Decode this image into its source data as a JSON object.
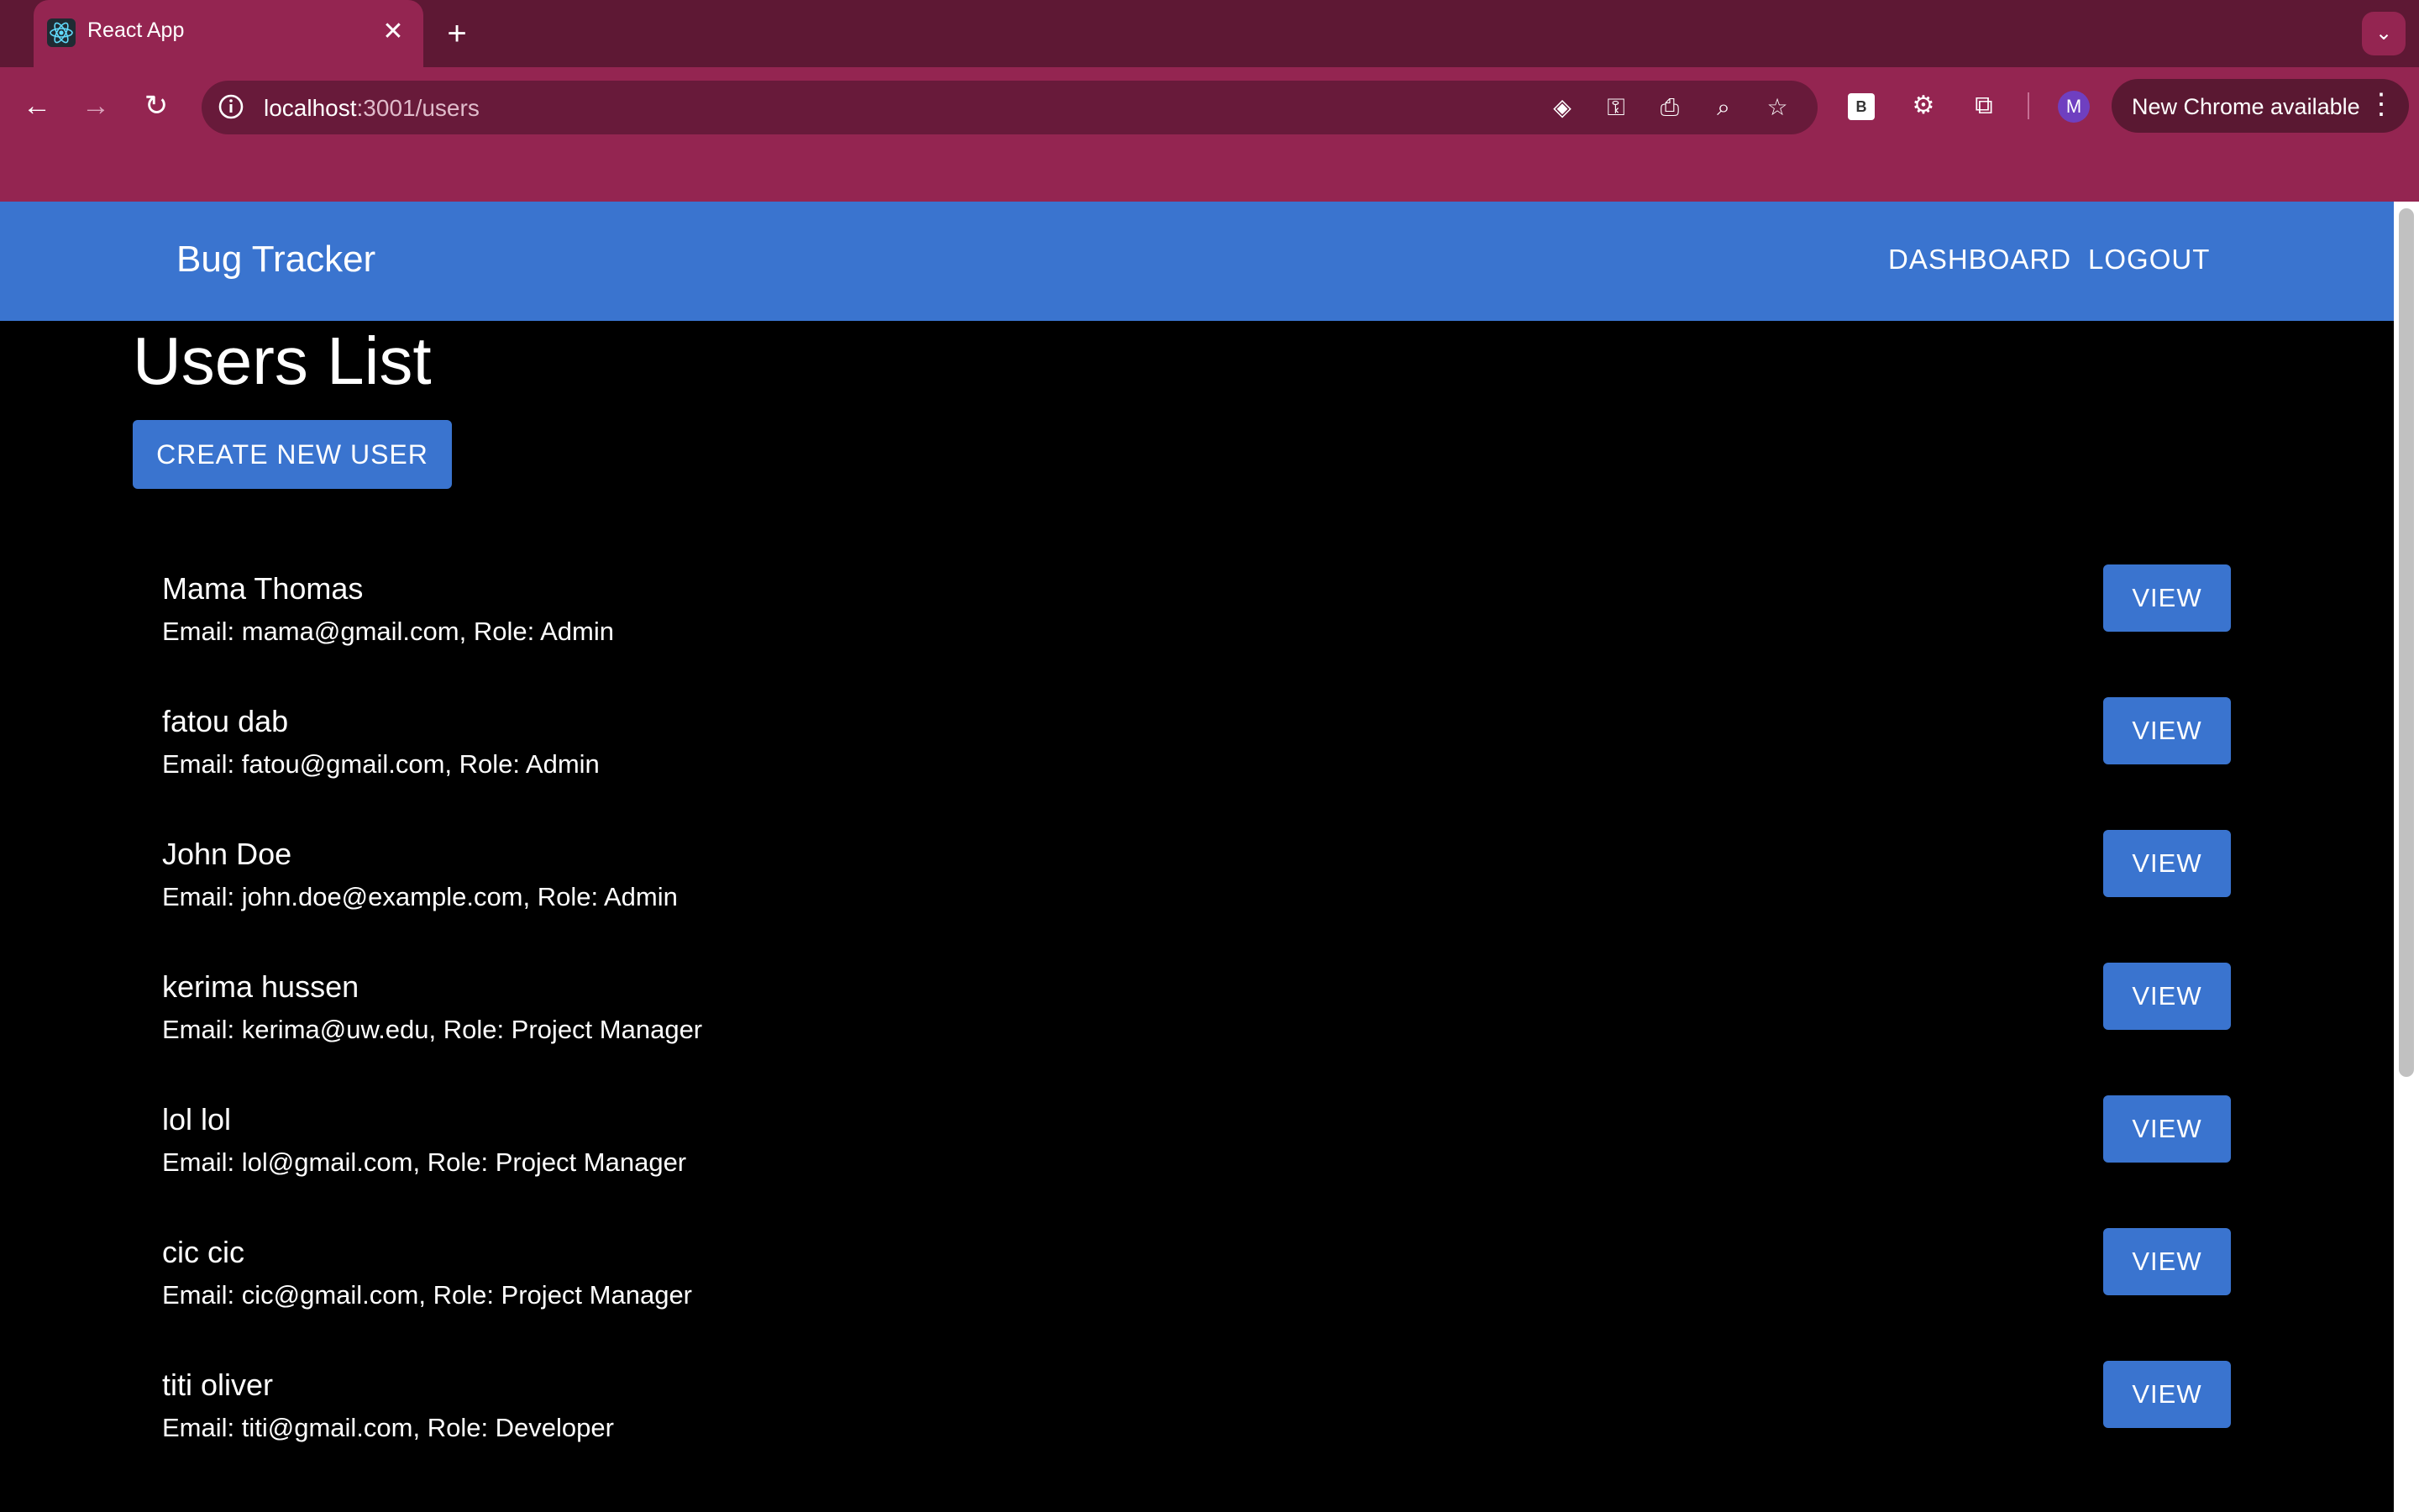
{
  "browser": {
    "tab_title": "React App",
    "url_host": "localhost",
    "url_rest": ":3001/users",
    "update_label": "New Chrome available",
    "profile_initial": "M",
    "ext_b_label": "B"
  },
  "app": {
    "brand": "Bug Tracker",
    "nav": {
      "dashboard": "DASHBOARD",
      "logout": "LOGOUT"
    }
  },
  "page": {
    "title": "Users List",
    "create_label": "CREATE NEW USER",
    "view_label": "VIEW"
  },
  "users": [
    {
      "name": "Mama Thomas",
      "detail": "Email: mama@gmail.com, Role: Admin"
    },
    {
      "name": "fatou dab",
      "detail": "Email: fatou@gmail.com, Role: Admin"
    },
    {
      "name": "John Doe",
      "detail": "Email: john.doe@example.com, Role: Admin"
    },
    {
      "name": "kerima hussen",
      "detail": "Email: kerima@uw.edu, Role: Project Manager"
    },
    {
      "name": "lol lol",
      "detail": "Email: lol@gmail.com, Role: Project Manager"
    },
    {
      "name": "cic cic",
      "detail": "Email: cic@gmail.com, Role: Project Manager"
    },
    {
      "name": "titi oliver",
      "detail": "Email: titi@gmail.com, Role: Developer"
    }
  ],
  "colors": {
    "tabstrip": "#5e1834",
    "toolbar": "#942551",
    "appbar": "#3a74cf",
    "background": "#000000"
  },
  "icons": [
    "react-favicon-icon",
    "close-icon",
    "plus-icon",
    "chevron-down-icon",
    "back-arrow-icon",
    "forward-arrow-icon",
    "reload-icon",
    "info-icon",
    "eye-off-icon",
    "key-icon",
    "install-icon",
    "zoom-icon",
    "star-icon",
    "gear-icon",
    "puzzle-icon",
    "more-vert-icon"
  ]
}
